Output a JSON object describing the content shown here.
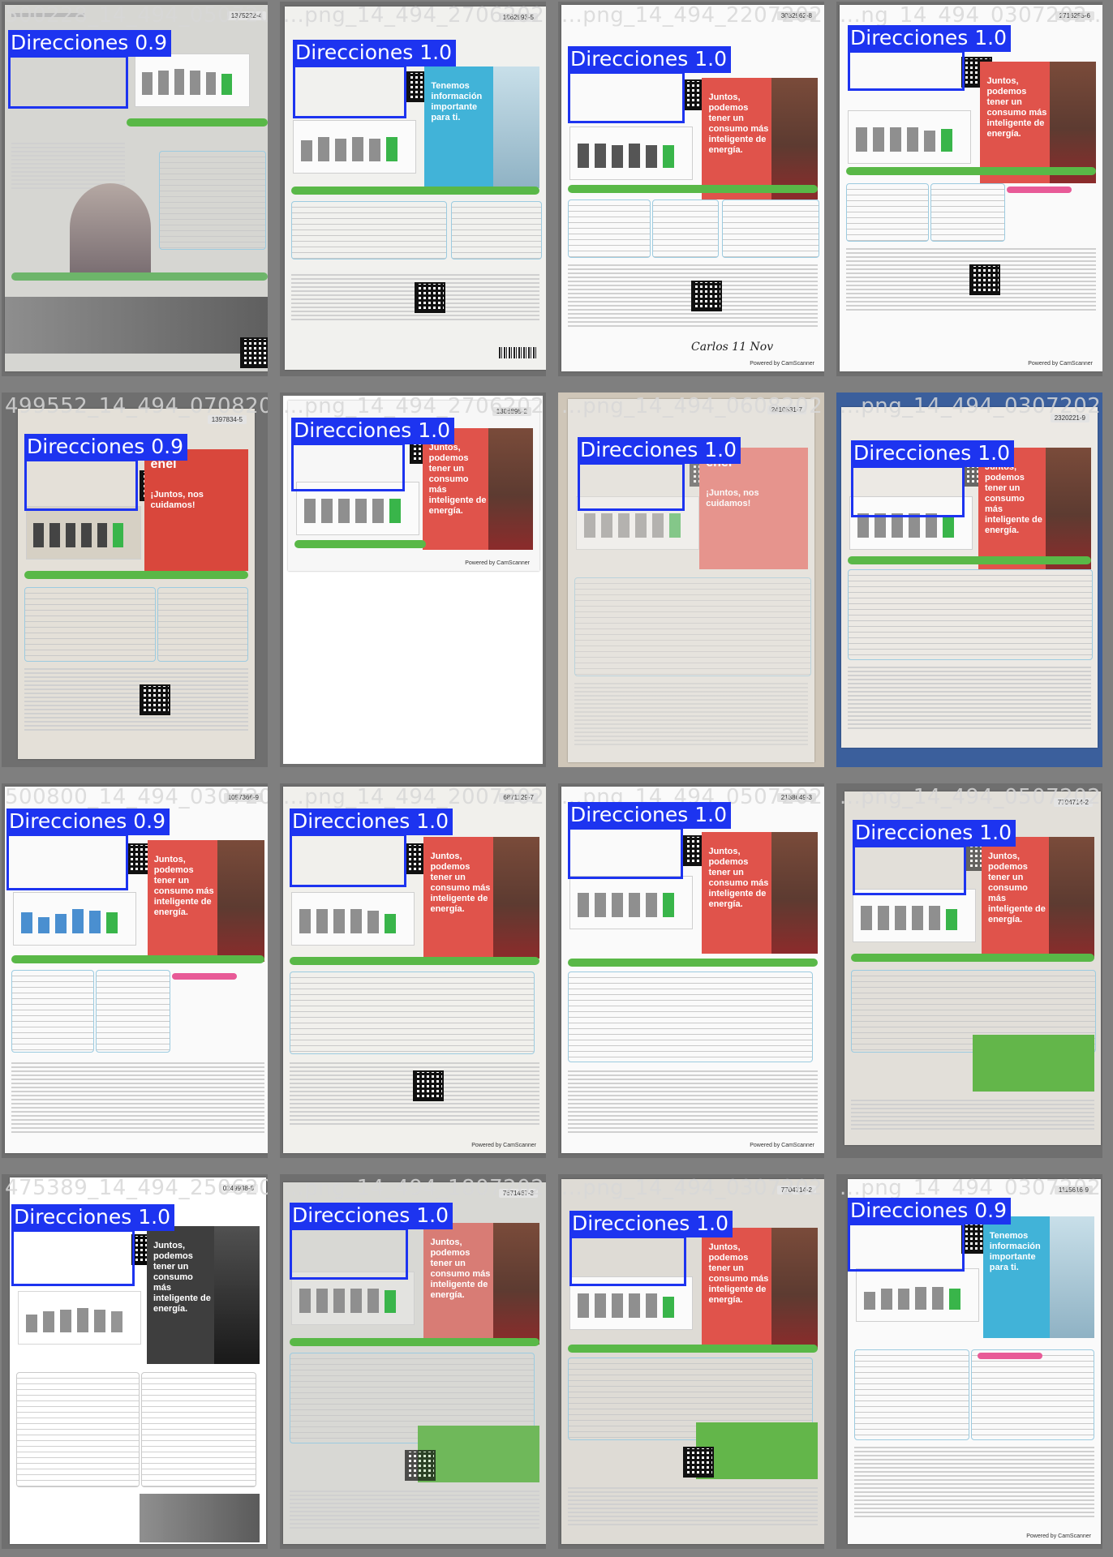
{
  "tiles": [
    {
      "file": "500228_14_494_0507202...",
      "label": "Direcciones 0.9",
      "account": "1375222-4"
    },
    {
      "file": "...png_14_494_2706202...",
      "label": "Direcciones 1.0",
      "account": "1862993-5"
    },
    {
      "file": "...png_14_494_2207202...",
      "label": "Direcciones 1.0",
      "account": "3082962-8"
    },
    {
      "file": "...ng_14_494_0307202...",
      "label": "Direcciones 1.0",
      "account": "2716255-6"
    },
    {
      "file": "499552_14_494_0708202...",
      "label": "Direcciones 0.9",
      "account": "1397834-5"
    },
    {
      "file": "...png_14_494_2706202...",
      "label": "Direcciones 1.0",
      "account": "1386895-2"
    },
    {
      "file": "...png_14_494_0608202...",
      "label": "Direcciones 1.0",
      "account": "2410531-7"
    },
    {
      "file": "...png_14_494_0307202...",
      "label": "Direcciones 1.0",
      "account": "2320221-9"
    },
    {
      "file": "500800_14_494_0307202...",
      "label": "Direcciones 0.9",
      "account": "1057366-9"
    },
    {
      "file": "...png_14_494_2007202...",
      "label": "Direcciones 1.0",
      "account": "6871129-7"
    },
    {
      "file": "...png_14_494_0507202...",
      "label": "Direcciones 1.0",
      "account": "2188649-3"
    },
    {
      "file": "...png_14_494_0507202...",
      "label": "Direcciones 1.0",
      "account": "7704714-2"
    },
    {
      "file": "475389_14_494_2506202...",
      "label": "Direcciones 1.0",
      "account": "0249938-8"
    },
    {
      "file": "...png_14_494_1807202...",
      "label": "Direcciones 1.0",
      "account": "7671467-3"
    },
    {
      "file": "...png_14_494_0307202...",
      "label": "Direcciones 1.0",
      "account": "7704714-2"
    },
    {
      "file": "...png_14_494_0307202...",
      "label": "Direcciones 0.9",
      "account": "1115616-9"
    }
  ],
  "promo_texts": {
    "juntos": "Juntos, podemos tener un consumo más inteligente de energía.",
    "tenemos": "Tenemos información importante para ti.",
    "cuidantes": "¡Juntos, nos cuidamos!",
    "enel": "enel"
  },
  "scanner_label": "Powered by CamScanner",
  "signature": "Carlos 11 Nov"
}
